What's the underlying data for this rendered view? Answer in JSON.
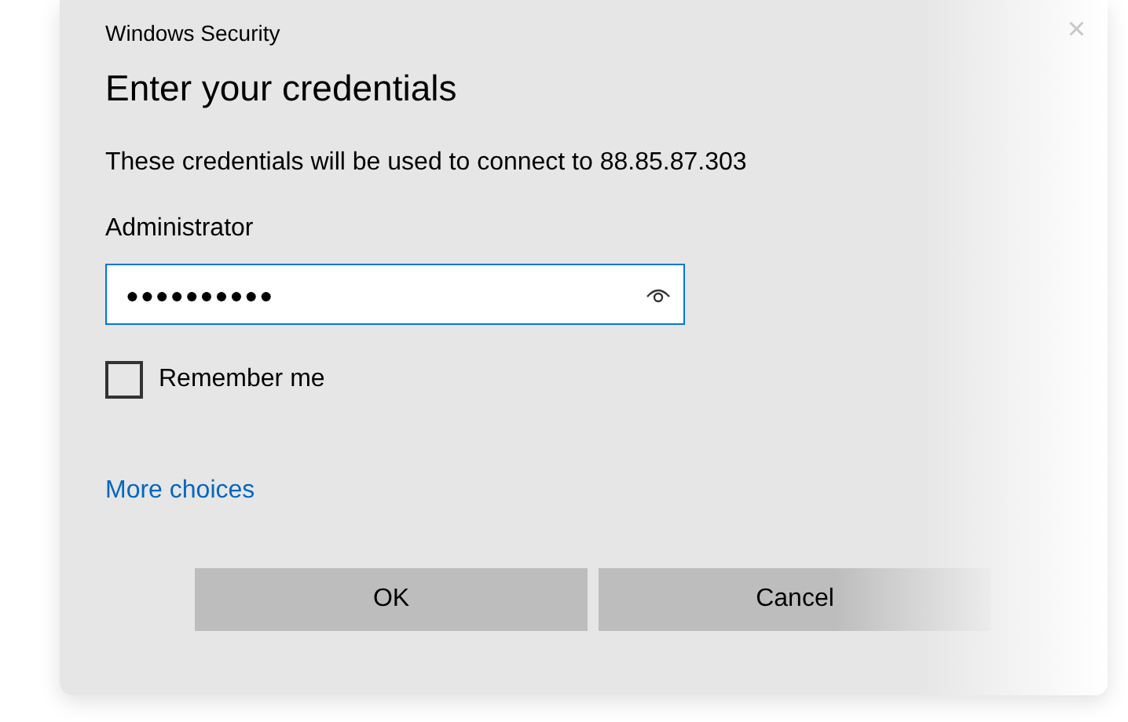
{
  "window": {
    "title": "Windows Security",
    "close": "×"
  },
  "heading": "Enter your credentials",
  "message": "These credentials will be used to connect to 88.85.87.303",
  "username": "Administrator",
  "password": {
    "value": "●●●●●●●●●●"
  },
  "remember": {
    "label": "Remember me",
    "checked": false
  },
  "more_choices": "More choices",
  "buttons": [
    "OK",
    "Cancel"
  ]
}
